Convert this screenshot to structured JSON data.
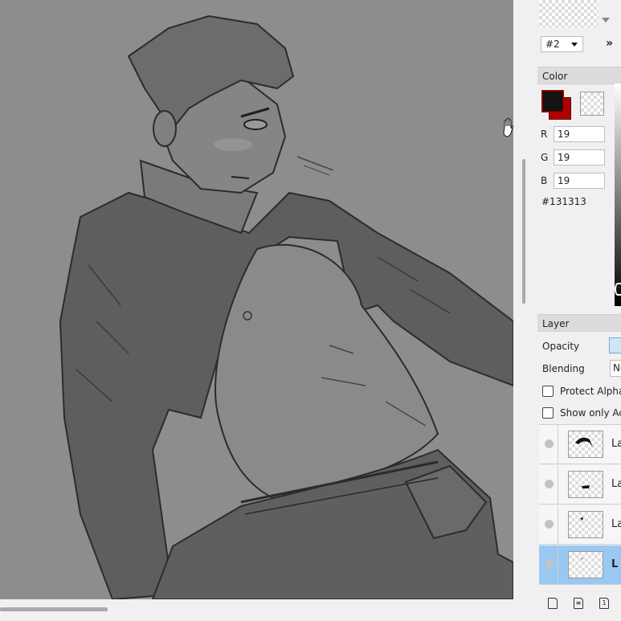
{
  "brush": {
    "preset_label": "#2",
    "more_label": "»"
  },
  "color": {
    "title": "Color",
    "primary": "#131313",
    "secondary": "#b00000",
    "r_label": "R",
    "g_label": "G",
    "b_label": "B",
    "r": "19",
    "g": "19",
    "b": "19",
    "hex": "#131313"
  },
  "layer": {
    "title": "Layer",
    "opacity_label": "Opacity",
    "blending_label": "Blending",
    "blending_value": "No",
    "protect_alpha_label": "Protect Alpha",
    "show_only_active_label": "Show only Ac",
    "items": [
      {
        "label": "La",
        "selected": false
      },
      {
        "label": "La",
        "selected": false
      },
      {
        "label": "La",
        "selected": false
      },
      {
        "label": "L",
        "selected": true
      }
    ]
  },
  "icons": {
    "pan": "hand-cursor-icon",
    "new_layer": "new-layer-icon",
    "duplicate_layer": "duplicate-layer-icon",
    "merge_layer": "merge-layer-icon"
  },
  "colors": {
    "canvas_bg": "#8d8d8d",
    "selection": "#99c9f3",
    "panel_bg": "#f0f0f0"
  }
}
